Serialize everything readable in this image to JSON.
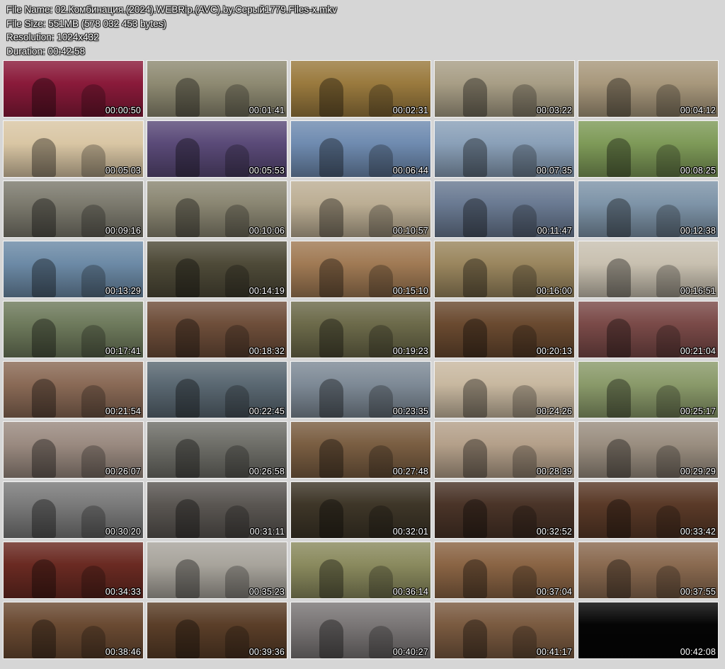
{
  "header": {
    "file_name": "File Name: 02.Комбинация.(2024).WEBRip.(AVC).by.Серый1779.Files-x.mkv",
    "file_size": "File Size: 551MB (578 032 453 bytes)",
    "resolution": "Resolution: 1024x432",
    "duration": "Duration: 00:42:58"
  },
  "thumbnails": [
    {
      "time": "00:00:50",
      "color": "#8a1a3a"
    },
    {
      "time": "00:01:41",
      "color": "#8e8a72"
    },
    {
      "time": "00:02:31",
      "color": "#9a7a3e"
    },
    {
      "time": "00:03:22",
      "color": "#a89e86"
    },
    {
      "time": "00:04:12",
      "color": "#a8987c"
    },
    {
      "time": "00:05:03",
      "color": "#d9c6a4"
    },
    {
      "time": "00:05:53",
      "color": "#5a4a78"
    },
    {
      "time": "00:06:44",
      "color": "#6f8bb0"
    },
    {
      "time": "00:07:35",
      "color": "#8aa0b8"
    },
    {
      "time": "00:08:25",
      "color": "#7e9a58"
    },
    {
      "time": "00:09:16",
      "color": "#7c7a6e"
    },
    {
      "time": "00:10:06",
      "color": "#8a8672"
    },
    {
      "time": "00:10:57",
      "color": "#bcae94"
    },
    {
      "time": "00:11:47",
      "color": "#6a7a92"
    },
    {
      "time": "00:12:38",
      "color": "#7e94a8"
    },
    {
      "time": "00:13:29",
      "color": "#6c8aa6"
    },
    {
      "time": "00:14:19",
      "color": "#4e4a38"
    },
    {
      "time": "00:15:10",
      "color": "#a07a54"
    },
    {
      "time": "00:16:00",
      "color": "#9a865e"
    },
    {
      "time": "00:16:51",
      "color": "#c8c0b0"
    },
    {
      "time": "00:17:41",
      "color": "#6e7a5c"
    },
    {
      "time": "00:18:32",
      "color": "#6e4e3a"
    },
    {
      "time": "00:19:23",
      "color": "#6c6a4a"
    },
    {
      "time": "00:20:13",
      "color": "#6a4a30"
    },
    {
      "time": "00:21:04",
      "color": "#7a4a48"
    },
    {
      "time": "00:21:54",
      "color": "#8a6a56"
    },
    {
      "time": "00:22:45",
      "color": "#5a6872"
    },
    {
      "time": "00:23:35",
      "color": "#7e8a96"
    },
    {
      "time": "00:24:26",
      "color": "#c8b8a0"
    },
    {
      "time": "00:25:17",
      "color": "#8a9a6a"
    },
    {
      "time": "00:26:07",
      "color": "#9a8a80"
    },
    {
      "time": "00:26:58",
      "color": "#6e6e68"
    },
    {
      "time": "00:27:48",
      "color": "#7a5e42"
    },
    {
      "time": "00:28:39",
      "color": "#b4a08a"
    },
    {
      "time": "00:29:29",
      "color": "#9a8e80"
    },
    {
      "time": "00:30:20",
      "color": "#7a7a7a"
    },
    {
      "time": "00:31:11",
      "color": "#5a5652"
    },
    {
      "time": "00:32:01",
      "color": "#3e3628"
    },
    {
      "time": "00:32:52",
      "color": "#4a3428"
    },
    {
      "time": "00:33:42",
      "color": "#5a3a28"
    },
    {
      "time": "00:34:33",
      "color": "#6a2a22"
    },
    {
      "time": "00:35:23",
      "color": "#a8a49c"
    },
    {
      "time": "00:36:14",
      "color": "#8a8a5e"
    },
    {
      "time": "00:37:04",
      "color": "#8a6444"
    },
    {
      "time": "00:37:55",
      "color": "#8a6a50"
    },
    {
      "time": "00:38:46",
      "color": "#6a4a32"
    },
    {
      "time": "00:39:36",
      "color": "#5a3e28"
    },
    {
      "time": "00:40:27",
      "color": "#7a7676"
    },
    {
      "time": "00:41:17",
      "color": "#7a5a40"
    },
    {
      "time": "00:42:08",
      "color": "#050505"
    }
  ]
}
